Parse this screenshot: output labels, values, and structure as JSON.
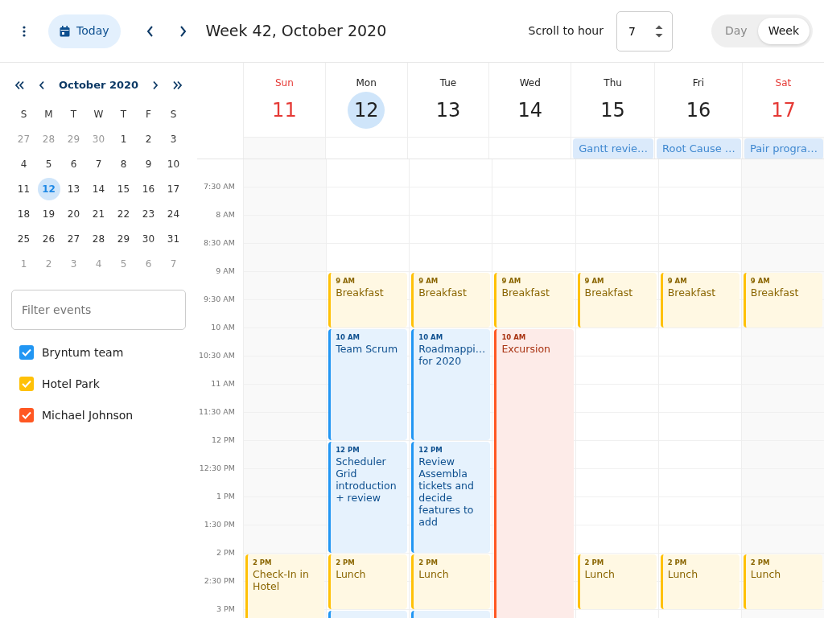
{
  "toolbar": {
    "today": "Today",
    "title": "Week 42, October 2020",
    "scroll_label": "Scroll to hour",
    "scroll_value": "7",
    "modes": [
      {
        "label": "Day",
        "selected": false
      },
      {
        "label": "Week",
        "selected": true
      }
    ]
  },
  "mini_calendar": {
    "title": "October 2020",
    "weekdays": [
      "S",
      "M",
      "T",
      "W",
      "T",
      "F",
      "S"
    ],
    "weeks": [
      [
        {
          "day": "27",
          "outside": true,
          "selected": false
        },
        {
          "day": "28",
          "outside": true,
          "selected": false
        },
        {
          "day": "29",
          "outside": true,
          "selected": false
        },
        {
          "day": "30",
          "outside": true,
          "selected": false
        },
        {
          "day": "1",
          "outside": false,
          "selected": false
        },
        {
          "day": "2",
          "outside": false,
          "selected": false
        },
        {
          "day": "3",
          "outside": false,
          "selected": false
        }
      ],
      [
        {
          "day": "4",
          "outside": false,
          "selected": false
        },
        {
          "day": "5",
          "outside": false,
          "selected": false
        },
        {
          "day": "6",
          "outside": false,
          "selected": false
        },
        {
          "day": "7",
          "outside": false,
          "selected": false
        },
        {
          "day": "8",
          "outside": false,
          "selected": false
        },
        {
          "day": "9",
          "outside": false,
          "selected": false
        },
        {
          "day": "10",
          "outside": false,
          "selected": false
        }
      ],
      [
        {
          "day": "11",
          "outside": false,
          "selected": false
        },
        {
          "day": "12",
          "outside": false,
          "selected": true
        },
        {
          "day": "13",
          "outside": false,
          "selected": false
        },
        {
          "day": "14",
          "outside": false,
          "selected": false
        },
        {
          "day": "15",
          "outside": false,
          "selected": false
        },
        {
          "day": "16",
          "outside": false,
          "selected": false
        },
        {
          "day": "17",
          "outside": false,
          "selected": false
        }
      ],
      [
        {
          "day": "18",
          "outside": false,
          "selected": false
        },
        {
          "day": "19",
          "outside": false,
          "selected": false
        },
        {
          "day": "20",
          "outside": false,
          "selected": false
        },
        {
          "day": "21",
          "outside": false,
          "selected": false
        },
        {
          "day": "22",
          "outside": false,
          "selected": false
        },
        {
          "day": "23",
          "outside": false,
          "selected": false
        },
        {
          "day": "24",
          "outside": false,
          "selected": false
        }
      ],
      [
        {
          "day": "25",
          "outside": false,
          "selected": false
        },
        {
          "day": "26",
          "outside": false,
          "selected": false
        },
        {
          "day": "27",
          "outside": false,
          "selected": false
        },
        {
          "day": "28",
          "outside": false,
          "selected": false
        },
        {
          "day": "29",
          "outside": false,
          "selected": false
        },
        {
          "day": "30",
          "outside": false,
          "selected": false
        },
        {
          "day": "31",
          "outside": false,
          "selected": false
        }
      ],
      [
        {
          "day": "1",
          "outside": true,
          "selected": false
        },
        {
          "day": "2",
          "outside": true,
          "selected": false
        },
        {
          "day": "3",
          "outside": true,
          "selected": false
        },
        {
          "day": "4",
          "outside": true,
          "selected": false
        },
        {
          "day": "5",
          "outside": true,
          "selected": false
        },
        {
          "day": "6",
          "outside": true,
          "selected": false
        },
        {
          "day": "7",
          "outside": true,
          "selected": false
        }
      ]
    ]
  },
  "filter": {
    "placeholder": "Filter events"
  },
  "resources": [
    {
      "name": "Bryntum team",
      "checked": true,
      "color": "#2196f3"
    },
    {
      "name": "Hotel Park",
      "checked": true,
      "color": "#ffc107"
    },
    {
      "name": "Michael Johnson",
      "checked": true,
      "color": "#ff5722"
    }
  ],
  "time_labels": [
    "7:30 AM",
    "8 AM",
    "8:30 AM",
    "9 AM",
    "9:30 AM",
    "10 AM",
    "10:30 AM",
    "11 AM",
    "11:30 AM",
    "12 PM",
    "12:30 PM",
    "1 PM",
    "1:30 PM",
    "2 PM",
    "2:30 PM",
    "3 PM"
  ],
  "days": [
    {
      "weekday": "Sun",
      "date": "11",
      "weekend": true,
      "selected": false,
      "events": [
        {
          "kind": "hotel",
          "time": "2 PM",
          "title": "Check-In in Hotel"
        }
      ]
    },
    {
      "weekday": "Mon",
      "date": "12",
      "weekend": false,
      "selected": true,
      "events": [
        {
          "kind": "hotel",
          "time": "9 AM",
          "title": "Breakfast"
        },
        {
          "kind": "team",
          "time": "10 AM",
          "title": "Team Scrum"
        },
        {
          "kind": "team",
          "time": "12 PM",
          "title": "Scheduler Grid introduction + review"
        },
        {
          "kind": "hotel",
          "time": "2 PM",
          "title": "Lunch"
        },
        {
          "kind": "team"
        }
      ]
    },
    {
      "weekday": "Tue",
      "date": "13",
      "weekend": false,
      "selected": false,
      "events": [
        {
          "kind": "hotel",
          "time": "9 AM",
          "title": "Breakfast"
        },
        {
          "kind": "team",
          "time": "10 AM",
          "title": "Roadmappi… for 2020"
        },
        {
          "kind": "team",
          "time": "12 PM",
          "title": "Review Assembla tickets and decide features to add"
        },
        {
          "kind": "hotel",
          "time": "2 PM",
          "title": "Lunch"
        },
        {
          "kind": "team"
        }
      ]
    },
    {
      "weekday": "Wed",
      "date": "14",
      "weekend": false,
      "selected": false,
      "events": [
        {
          "kind": "hotel",
          "time": "9 AM",
          "title": "Breakfast"
        },
        {
          "kind": "personal",
          "time": "10 AM",
          "title": "Excursion"
        }
      ]
    },
    {
      "weekday": "Thu",
      "date": "15",
      "weekend": false,
      "selected": false,
      "all_day": [
        "Gantt revie…"
      ],
      "events": [
        {
          "kind": "hotel",
          "time": "9 AM",
          "title": "Breakfast"
        },
        {
          "kind": "hotel",
          "time": "2 PM",
          "title": "Lunch"
        }
      ]
    },
    {
      "weekday": "Fri",
      "date": "16",
      "weekend": false,
      "selected": false,
      "all_day": [
        "Root Cause …"
      ],
      "events": [
        {
          "kind": "hotel",
          "time": "9 AM",
          "title": "Breakfast"
        },
        {
          "kind": "hotel",
          "time": "2 PM",
          "title": "Lunch"
        }
      ]
    },
    {
      "weekday": "Sat",
      "date": "17",
      "weekend": true,
      "selected": false,
      "all_day": [
        "Pair progra…"
      ],
      "events": [
        {
          "kind": "hotel",
          "time": "9 AM",
          "title": "Breakfast"
        },
        {
          "kind": "hotel",
          "time": "2 PM",
          "title": "Lunch"
        }
      ]
    }
  ]
}
